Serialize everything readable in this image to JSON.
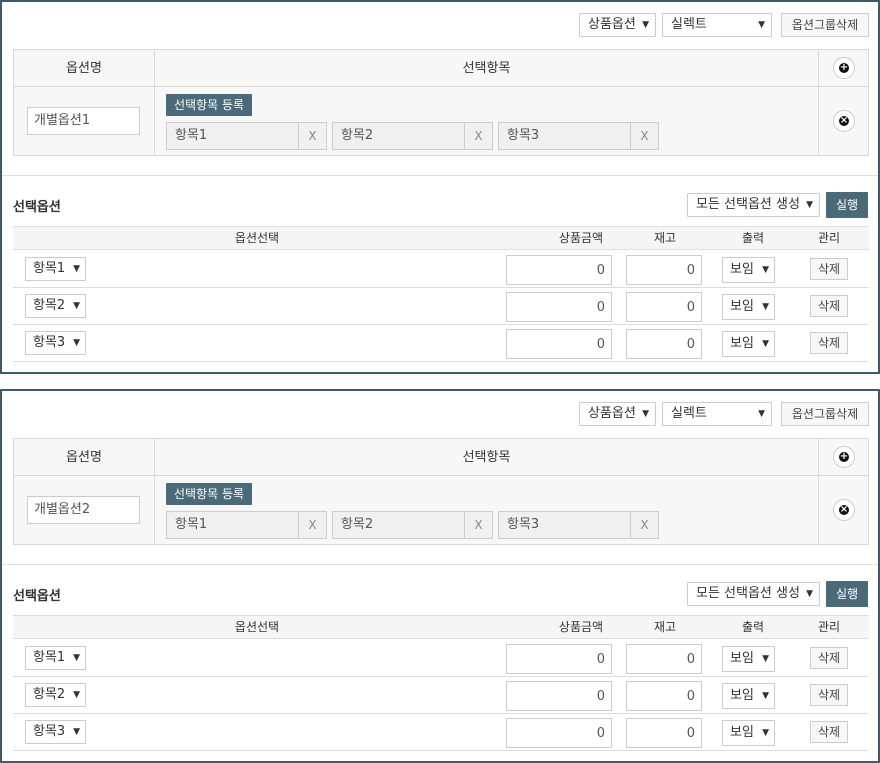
{
  "panels": [
    {
      "top_controls": {
        "type_select": "상품옵션",
        "display_select": "실렉트",
        "delete_group": "옵션그룹삭제"
      },
      "option_table": {
        "col_name": "옵션명",
        "col_items": "선택항목",
        "name_value": "개별옵션1",
        "register_button": "선택항목 등록",
        "items": [
          "항목1",
          "항목2",
          "항목3"
        ],
        "remove_glyph": "X"
      },
      "select_section": {
        "title": "선택옵션",
        "generate_select": "모든 선택옵션 생성",
        "run_button": "실행",
        "headers": [
          "옵션선택",
          "상품금액",
          "재고",
          "출력",
          "관리"
        ],
        "rows": [
          {
            "item": "항목1",
            "price": "0",
            "stock": "0",
            "display": "보임",
            "action": "삭제"
          },
          {
            "item": "항목2",
            "price": "0",
            "stock": "0",
            "display": "보임",
            "action": "삭제"
          },
          {
            "item": "항목3",
            "price": "0",
            "stock": "0",
            "display": "보임",
            "action": "삭제"
          }
        ]
      }
    },
    {
      "top_controls": {
        "type_select": "상품옵션",
        "display_select": "실렉트",
        "delete_group": "옵션그룹삭제"
      },
      "option_table": {
        "col_name": "옵션명",
        "col_items": "선택항목",
        "name_value": "개별옵션2",
        "register_button": "선택항목 등록",
        "items": [
          "항목1",
          "항목2",
          "항목3"
        ],
        "remove_glyph": "X"
      },
      "select_section": {
        "title": "선택옵션",
        "generate_select": "모든 선택옵션 생성",
        "run_button": "실행",
        "headers": [
          "옵션선택",
          "상품금액",
          "재고",
          "출력",
          "관리"
        ],
        "rows": [
          {
            "item": "항목1",
            "price": "0",
            "stock": "0",
            "display": "보임",
            "action": "삭제"
          },
          {
            "item": "항목2",
            "price": "0",
            "stock": "0",
            "display": "보임",
            "action": "삭제"
          },
          {
            "item": "항목3",
            "price": "0",
            "stock": "0",
            "display": "보임",
            "action": "삭제"
          }
        ]
      }
    }
  ],
  "icons": {
    "add": "plus-circle-icon",
    "remove": "x-circle-icon",
    "dropdown": "caret-down-icon"
  },
  "colors": {
    "panel_border": "#3f5a68",
    "primary_button": "#4a6a7a",
    "header_bg": "#f5f5f5"
  }
}
